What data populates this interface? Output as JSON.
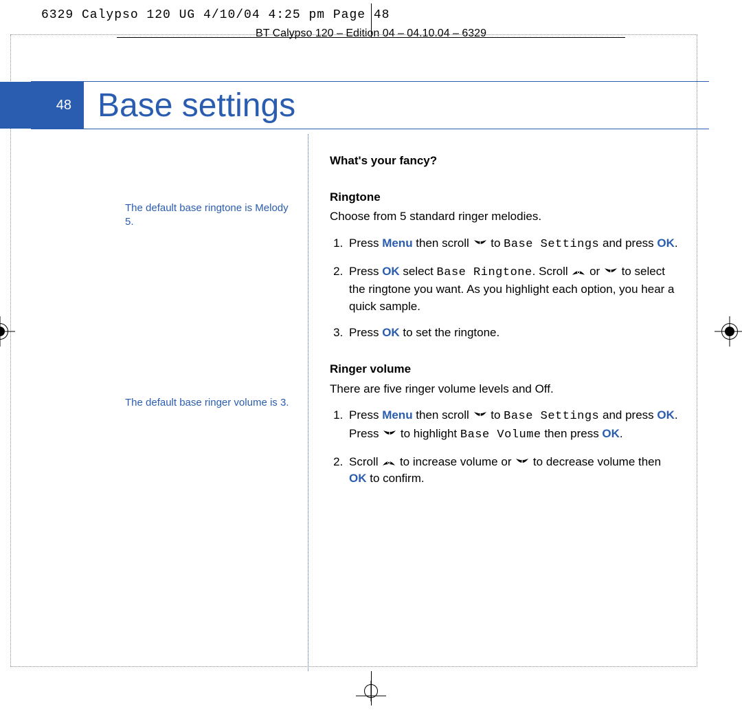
{
  "proof_header": "6329 Calypso 120 UG   4/10/04  4:25 pm  Page 48",
  "edition_line": "BT Calypso 120 – Edition 04 – 04.10.04 – 6329",
  "page_number": "48",
  "page_title": "Base settings",
  "side_notes": {
    "note1": "The default base ringtone is Melody 5.",
    "note2": "The default base ringer volume is 3."
  },
  "content": {
    "heading1": "What's your fancy?",
    "ringtone": {
      "title": "Ringtone",
      "intro": "Choose from 5 standard ringer melodies.",
      "step1_a": "Press ",
      "step1_menu": "Menu",
      "step1_b": " then scroll ",
      "step1_c": " to ",
      "step1_lcd": "Base Settings",
      "step1_d": " and press ",
      "step1_ok": "OK",
      "step1_e": ".",
      "step2_a": "Press ",
      "step2_ok1": "OK",
      "step2_b": " select ",
      "step2_lcd": "Base Ringtone",
      "step2_c": ". Scroll ",
      "step2_d": " or ",
      "step2_e": " to select the ringtone you want. As you highlight each option, you hear a quick sample.",
      "step3_a": "Press ",
      "step3_ok": "OK",
      "step3_b": " to set the ringtone."
    },
    "volume": {
      "title": "Ringer volume",
      "intro": "There are five ringer volume levels and Off.",
      "step1_a": "Press ",
      "step1_menu": "Menu",
      "step1_b": " then scroll ",
      "step1_c": " to ",
      "step1_lcd1": "Base Settings",
      "step1_d": " and press ",
      "step1_ok1": "OK",
      "step1_e": ". Press ",
      "step1_f": " to highlight ",
      "step1_lcd2": "Base Volume",
      "step1_g": " then press ",
      "step1_ok2": "OK",
      "step1_h": ".",
      "step2_a": "Scroll ",
      "step2_b": " to increase volume or ",
      "step2_c": " to decrease volume then ",
      "step2_ok": "OK",
      "step2_d": " to confirm."
    }
  }
}
